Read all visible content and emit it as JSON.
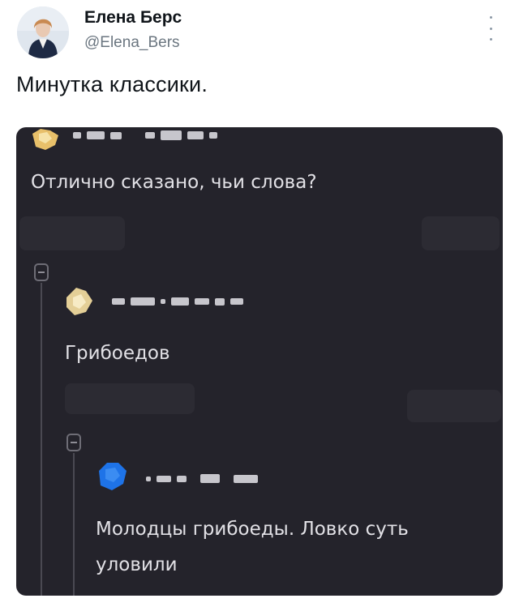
{
  "author": {
    "name": "Елена Берс",
    "handle": "@Elena_Bers"
  },
  "tweet": {
    "text": "Минутка классики."
  },
  "icons": {
    "more": "vertical-ellipsis-icon",
    "collapse": "collapse-thread-icon"
  },
  "media": {
    "comments": [
      {
        "text": "Отлично сказано, чьи слова?"
      },
      {
        "text": "Грибоедов"
      },
      {
        "text_line1": "Молодцы грибоеды. Ловко суть",
        "text_line2": "уловили"
      }
    ]
  },
  "colors": {
    "media_background": "#24232b",
    "comment_text": "#e2e1e6",
    "handle": "#6b7680"
  }
}
